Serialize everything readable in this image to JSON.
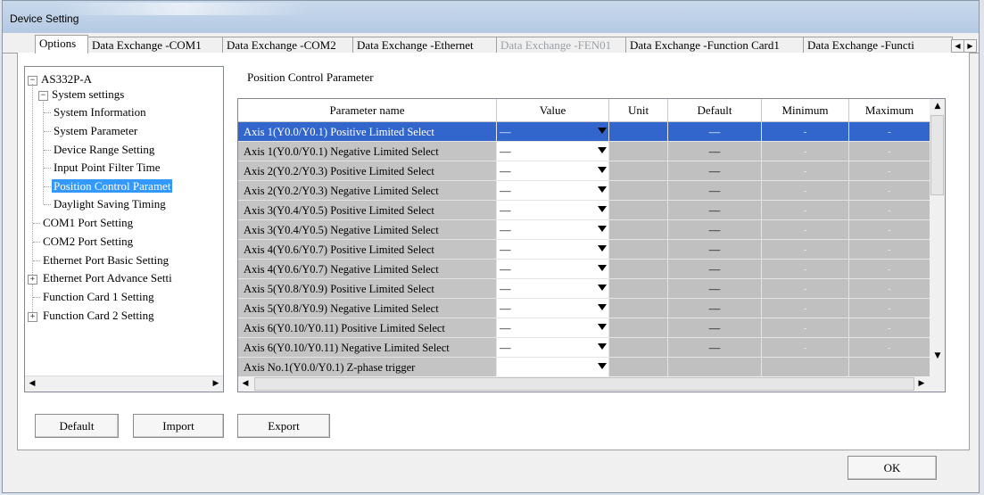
{
  "window": {
    "title": "Device Setting"
  },
  "tabs": [
    {
      "label": "Options",
      "active": true
    },
    {
      "label": "Data Exchange -COM1"
    },
    {
      "label": "Data Exchange -COM2"
    },
    {
      "label": "Data Exchange -Ethernet"
    },
    {
      "label": "Data Exchange -FEN01",
      "disabled": true
    },
    {
      "label": "Data Exchange -Function Card1"
    },
    {
      "label": "Data Exchange -Functi"
    }
  ],
  "tree": {
    "root": "AS332P-A",
    "system_settings": "System settings",
    "children": [
      "System Information",
      "System Parameter",
      "Device Range Setting",
      "Input Point Filter Time",
      "Position Control Paramet",
      "Daylight Saving Timing"
    ],
    "items": [
      "COM1 Port Setting",
      "COM2 Port Setting",
      "Ethernet Port Basic Setting",
      "Ethernet Port Advance Setti",
      "Function Card 1 Setting",
      "Function Card 2 Setting"
    ]
  },
  "section_title": "Position Control Parameter",
  "grid": {
    "headers": [
      "Parameter name",
      "Value",
      "Unit",
      "Default",
      "Minimum",
      "Maximum"
    ],
    "rows": [
      {
        "name": "Axis 1(Y0.0/Y0.1) Positive Limited Select",
        "value": "—",
        "default": "—",
        "min": "-",
        "max": "-"
      },
      {
        "name": "Axis 1(Y0.0/Y0.1) Negative Limited Select",
        "value": "—",
        "default": "—",
        "min": "-",
        "max": "-"
      },
      {
        "name": "Axis 2(Y0.2/Y0.3) Positive Limited Select",
        "value": "—",
        "default": "—",
        "min": "-",
        "max": "-"
      },
      {
        "name": "Axis 2(Y0.2/Y0.3) Negative Limited Select",
        "value": "—",
        "default": "—",
        "min": "-",
        "max": "-"
      },
      {
        "name": "Axis 3(Y0.4/Y0.5) Positive Limited Select",
        "value": "—",
        "default": "—",
        "min": "-",
        "max": "-"
      },
      {
        "name": "Axis 3(Y0.4/Y0.5) Negative Limited Select",
        "value": "—",
        "default": "—",
        "min": "-",
        "max": "-"
      },
      {
        "name": "Axis 4(Y0.6/Y0.7) Positive Limited Select",
        "value": "—",
        "default": "—",
        "min": "-",
        "max": "-"
      },
      {
        "name": "Axis 4(Y0.6/Y0.7) Negative Limited Select",
        "value": "—",
        "default": "—",
        "min": "-",
        "max": "-"
      },
      {
        "name": "Axis 5(Y0.8/Y0.9) Positive Limited Select",
        "value": "—",
        "default": "—",
        "min": "-",
        "max": "-"
      },
      {
        "name": "Axis 5(Y0.8/Y0.9) Negative Limited Select",
        "value": "—",
        "default": "—",
        "min": "-",
        "max": "-"
      },
      {
        "name": "Axis 6(Y0.10/Y0.11) Positive Limited Select",
        "value": "—",
        "default": "—",
        "min": "-",
        "max": "-"
      },
      {
        "name": "Axis 6(Y0.10/Y0.11) Negative Limited Select",
        "value": "—",
        "default": "—",
        "min": "-",
        "max": "-"
      },
      {
        "name": "Axis No.1(Y0.0/Y0.1) Z-phase trigger",
        "value": "",
        "default": "",
        "min": "",
        "max": ""
      }
    ]
  },
  "buttons": {
    "default": "Default",
    "import": "Import",
    "export": "Export",
    "ok": "OK"
  },
  "colors": {
    "selection": "#3366cc",
    "tree_selection": "#3399ff",
    "readonly_cell": "#c0c0c0"
  }
}
